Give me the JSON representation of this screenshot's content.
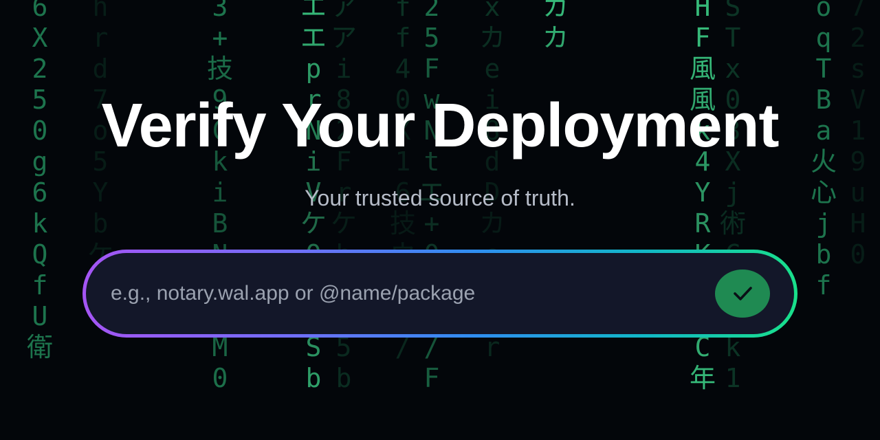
{
  "hero": {
    "title": "Verify Your Deployment",
    "subtitle": "Your trusted source of truth."
  },
  "search": {
    "placeholder": "e.g., notary.wal.app or @name/package",
    "value": "",
    "submit_icon": "check-icon"
  },
  "colors": {
    "background": "#03060a",
    "rain": "#22a86a",
    "input_bg": "#131729",
    "button": "#1f8a52",
    "gradient_start": "#a555f4",
    "gradient_mid": "#2f8ef0",
    "gradient_end": "#19e08a"
  }
}
